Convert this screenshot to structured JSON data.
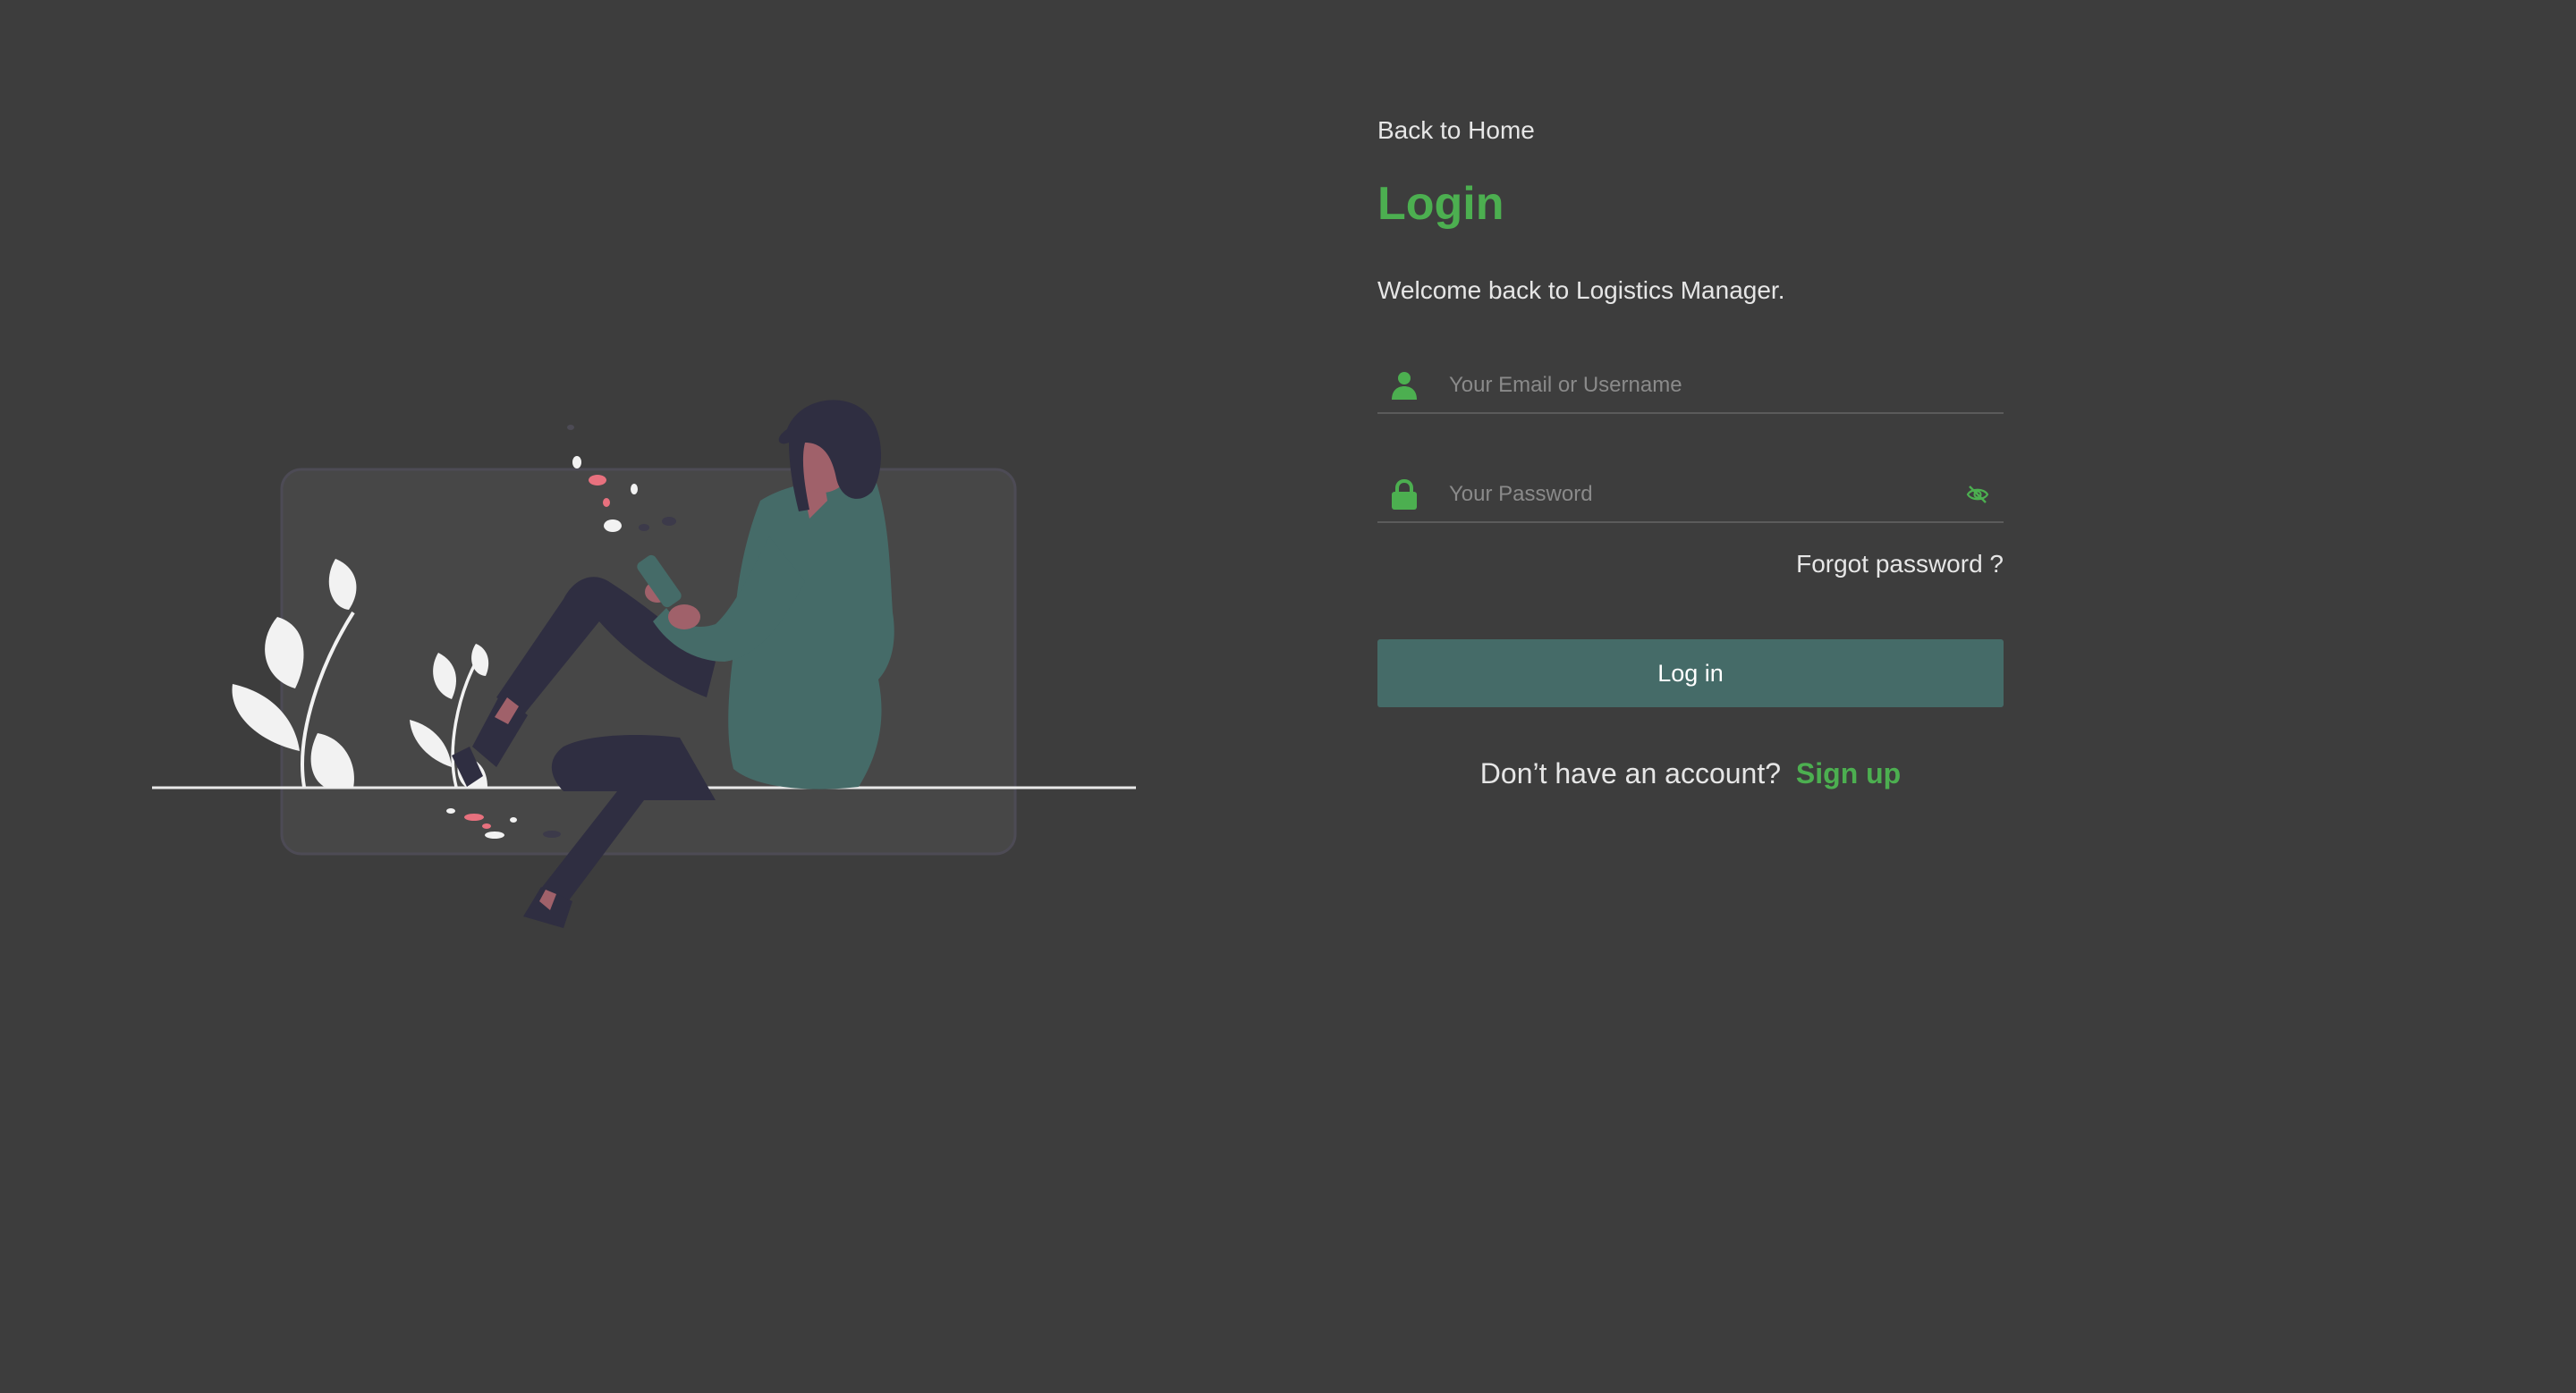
{
  "nav": {
    "back_label": "Back to Home"
  },
  "login": {
    "title": "Login",
    "welcome": "Welcome back to Logistics Manager.",
    "email_placeholder": "Your Email or Username",
    "password_placeholder": "Your Password",
    "forgot_label": "Forgot password ?",
    "submit_label": "Log in",
    "no_account_text": "Don’t have an account?",
    "signup_label": "Sign up"
  },
  "icons": {
    "user": "user-icon",
    "lock": "lock-icon",
    "visibility": "eye-off-icon"
  },
  "colors": {
    "background": "#3d3d3d",
    "accent": "#4caf50",
    "button": "#456b68",
    "text": "#e6e6e6",
    "placeholder": "#8a8a8a"
  }
}
